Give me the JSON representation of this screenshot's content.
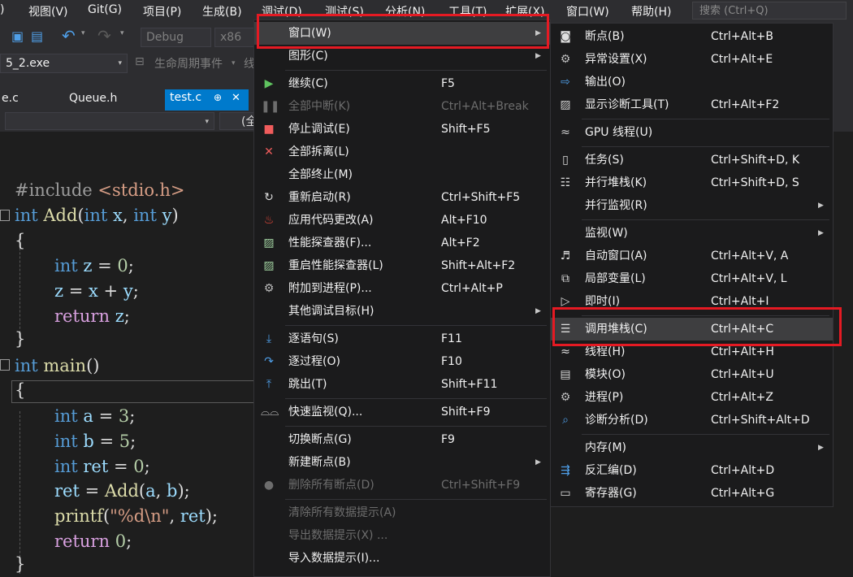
{
  "menubar": {
    "items": [
      ")",
      "视图(V)",
      "Git(G)",
      "项目(P)",
      "生成(B)",
      "调试(D)",
      "测试(S)",
      "分析(N)",
      "工具(T)",
      "扩展(X)",
      "窗口(W)",
      "帮助(H)"
    ],
    "search_placeholder": "搜索 (Ctrl+Q)"
  },
  "toolbar": {
    "config": "Debug",
    "platform": "x86",
    "process": "5_2.exe",
    "lifecycle": "生命周期事件",
    "thread_char": "线"
  },
  "tabs": [
    {
      "label": "e.c"
    },
    {
      "label": "Queue.h"
    },
    {
      "label": "test.c",
      "pin": "⊕",
      "close": "✕"
    }
  ],
  "navbar": {
    "scope": "(全"
  },
  "code_lines": [
    "#include <stdio.h>",
    "int Add(int x, int y)",
    "{",
    "int z = 0;",
    "z = x + y;",
    "return z;",
    "}",
    "int main()",
    "{",
    "int a = 3;",
    "int b = 5;",
    "int ret = 0;",
    "ret = Add(a, b);",
    "printf(\"%d\\n\", ret);",
    "return 0;",
    "}"
  ],
  "debug_menu": {
    "items": [
      {
        "label": "窗口(W)",
        "shortcut": "",
        "submenu": true,
        "icon": ""
      },
      {
        "label": "图形(C)",
        "shortcut": "",
        "submenu": true,
        "icon": ""
      },
      {
        "label": "继续(C)",
        "shortcut": "F5",
        "icon": "play-icon"
      },
      {
        "label": "全部中断(K)",
        "shortcut": "Ctrl+Alt+Break",
        "disabled": true,
        "icon": "pause-icon"
      },
      {
        "label": "停止调试(E)",
        "shortcut": "Shift+F5",
        "icon": "stop-icon"
      },
      {
        "label": "全部拆离(L)",
        "shortcut": "",
        "icon": "detach-icon"
      },
      {
        "label": "全部终止(M)",
        "shortcut": "",
        "icon": ""
      },
      {
        "label": "重新启动(R)",
        "shortcut": "Ctrl+Shift+F5",
        "icon": "restart-icon"
      },
      {
        "label": "应用代码更改(A)",
        "shortcut": "Alt+F10",
        "icon": "flame-icon"
      },
      {
        "label": "性能探查器(F)...",
        "shortcut": "Alt+F2",
        "icon": "perf-icon"
      },
      {
        "label": "重启性能探查器(L)",
        "shortcut": "Shift+Alt+F2",
        "icon": "perf-icon"
      },
      {
        "label": "附加到进程(P)...",
        "shortcut": "Ctrl+Alt+P",
        "icon": "gear-icon"
      },
      {
        "label": "其他调试目标(H)",
        "shortcut": "",
        "submenu": true,
        "icon": ""
      },
      {
        "label": "逐语句(S)",
        "shortcut": "F11",
        "icon": "step-into-icon"
      },
      {
        "label": "逐过程(O)",
        "shortcut": "F10",
        "icon": "step-over-icon"
      },
      {
        "label": "跳出(T)",
        "shortcut": "Shift+F11",
        "icon": "step-out-icon"
      },
      {
        "label": "快速监视(Q)...",
        "shortcut": "Shift+F9",
        "icon": "glasses-icon"
      },
      {
        "label": "切换断点(G)",
        "shortcut": "F9",
        "icon": ""
      },
      {
        "label": "新建断点(B)",
        "shortcut": "",
        "submenu": true,
        "icon": ""
      },
      {
        "label": "删除所有断点(D)",
        "shortcut": "Ctrl+Shift+F9",
        "disabled": true,
        "icon": "breakpoints-icon"
      },
      {
        "label": "清除所有数据提示(A)",
        "shortcut": "",
        "disabled": true,
        "icon": ""
      },
      {
        "label": "导出数据提示(X) ...",
        "shortcut": "",
        "disabled": true,
        "icon": ""
      },
      {
        "label": "导入数据提示(I)...",
        "shortcut": "",
        "icon": ""
      }
    ]
  },
  "window_menu": {
    "items": [
      {
        "label": "断点(B)",
        "shortcut": "Ctrl+Alt+B",
        "icon": "breakpoint-window-icon"
      },
      {
        "label": "异常设置(X)",
        "shortcut": "Ctrl+Alt+E",
        "icon": "exception-icon"
      },
      {
        "label": "输出(O)",
        "shortcut": "",
        "icon": "output-icon"
      },
      {
        "label": "显示诊断工具(T)",
        "shortcut": "Ctrl+Alt+F2",
        "icon": "diagnostics-icon"
      },
      {
        "label": "GPU 线程(U)",
        "shortcut": "",
        "icon": "gpu-thread-icon"
      },
      {
        "label": "任务(S)",
        "shortcut": "Ctrl+Shift+D, K",
        "icon": "tasks-icon"
      },
      {
        "label": "并行堆栈(K)",
        "shortcut": "Ctrl+Shift+D, S",
        "icon": "parallel-stacks-icon"
      },
      {
        "label": "并行监视(R)",
        "shortcut": "",
        "submenu": true,
        "icon": ""
      },
      {
        "label": "监视(W)",
        "shortcut": "",
        "submenu": true,
        "icon": ""
      },
      {
        "label": "自动窗口(A)",
        "shortcut": "Ctrl+Alt+V, A",
        "icon": "autos-icon"
      },
      {
        "label": "局部变量(L)",
        "shortcut": "Ctrl+Alt+V, L",
        "icon": "locals-icon"
      },
      {
        "label": "即时(I)",
        "shortcut": "Ctrl+Alt+I",
        "icon": "immediate-icon"
      },
      {
        "label": "调用堆栈(C)",
        "shortcut": "Ctrl+Alt+C",
        "icon": "call-stack-icon"
      },
      {
        "label": "线程(H)",
        "shortcut": "Ctrl+Alt+H",
        "icon": "threads-icon"
      },
      {
        "label": "模块(O)",
        "shortcut": "Ctrl+Alt+U",
        "icon": "modules-icon"
      },
      {
        "label": "进程(P)",
        "shortcut": "Ctrl+Alt+Z",
        "icon": "processes-icon"
      },
      {
        "label": "诊断分析(D)",
        "shortcut": "Ctrl+Shift+Alt+D",
        "icon": "diag-analysis-icon"
      },
      {
        "label": "内存(M)",
        "shortcut": "",
        "submenu": true,
        "icon": ""
      },
      {
        "label": "反汇编(D)",
        "shortcut": "Ctrl+Alt+D",
        "icon": "disassembly-icon"
      },
      {
        "label": "寄存器(G)",
        "shortcut": "Ctrl+Alt+G",
        "icon": "registers-icon"
      }
    ]
  },
  "colors": {
    "highlight": "#e51a23",
    "accent": "#007acc",
    "menu_bg": "#1b1b1c"
  }
}
